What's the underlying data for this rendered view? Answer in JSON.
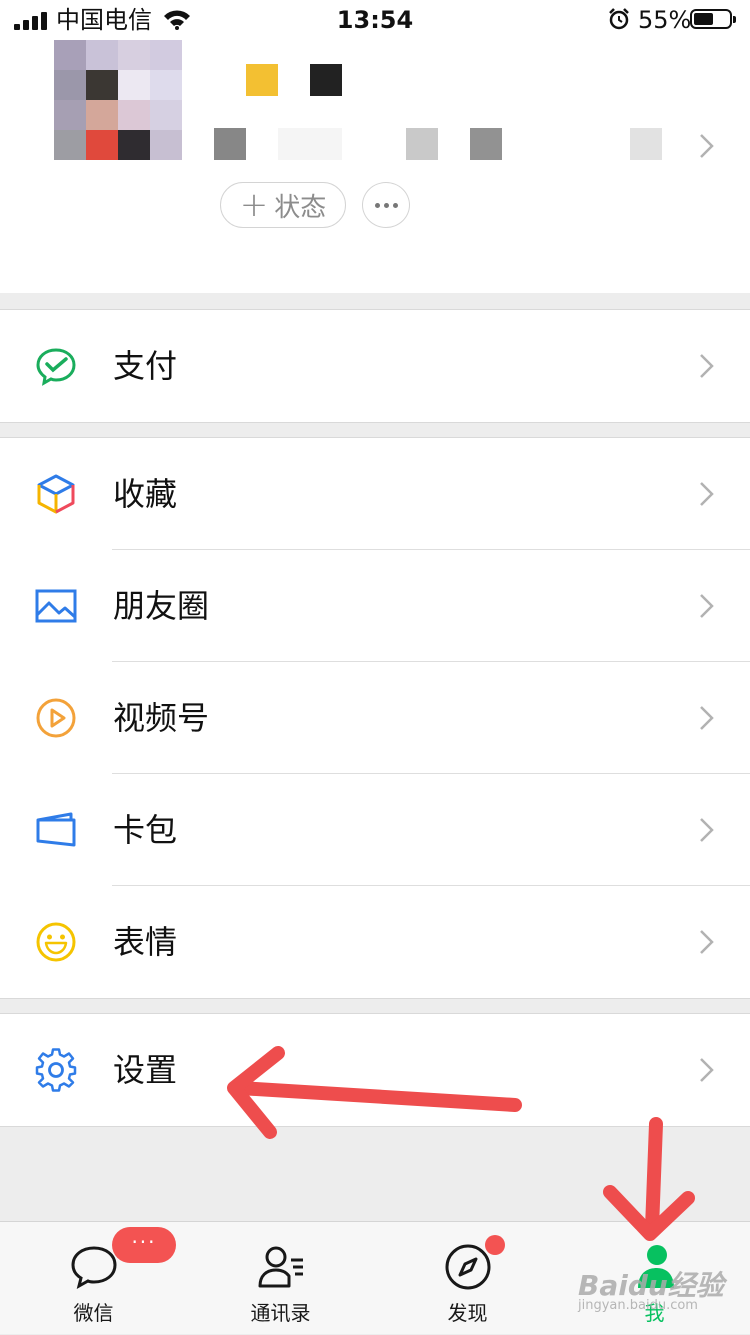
{
  "status_bar": {
    "carrier": "中国电信",
    "time": "13:54",
    "battery": "55%",
    "battery_level": 0.55,
    "icons": [
      "signal-icon",
      "wifi-icon",
      "alarm-icon",
      "battery-icon"
    ]
  },
  "profile": {
    "status_button": "状态",
    "status_plus": "+",
    "more_icon": "more-dots-icon"
  },
  "menu": {
    "pay": "支付",
    "favorites": "收藏",
    "moments": "朋友圈",
    "channels": "视频号",
    "cards": "卡包",
    "stickers": "表情",
    "settings": "设置"
  },
  "tabs": {
    "chats": "微信",
    "contacts": "通讯录",
    "discover": "发现",
    "me": "我",
    "chats_badge": "···"
  },
  "watermark": {
    "brand": "Baidu经验",
    "site": "jingyan.baidu.com"
  },
  "colors": {
    "accent_green": "#07c160",
    "badge_red": "#f35352",
    "arrow_red": "#ee4d4d",
    "background": "#ededed"
  }
}
